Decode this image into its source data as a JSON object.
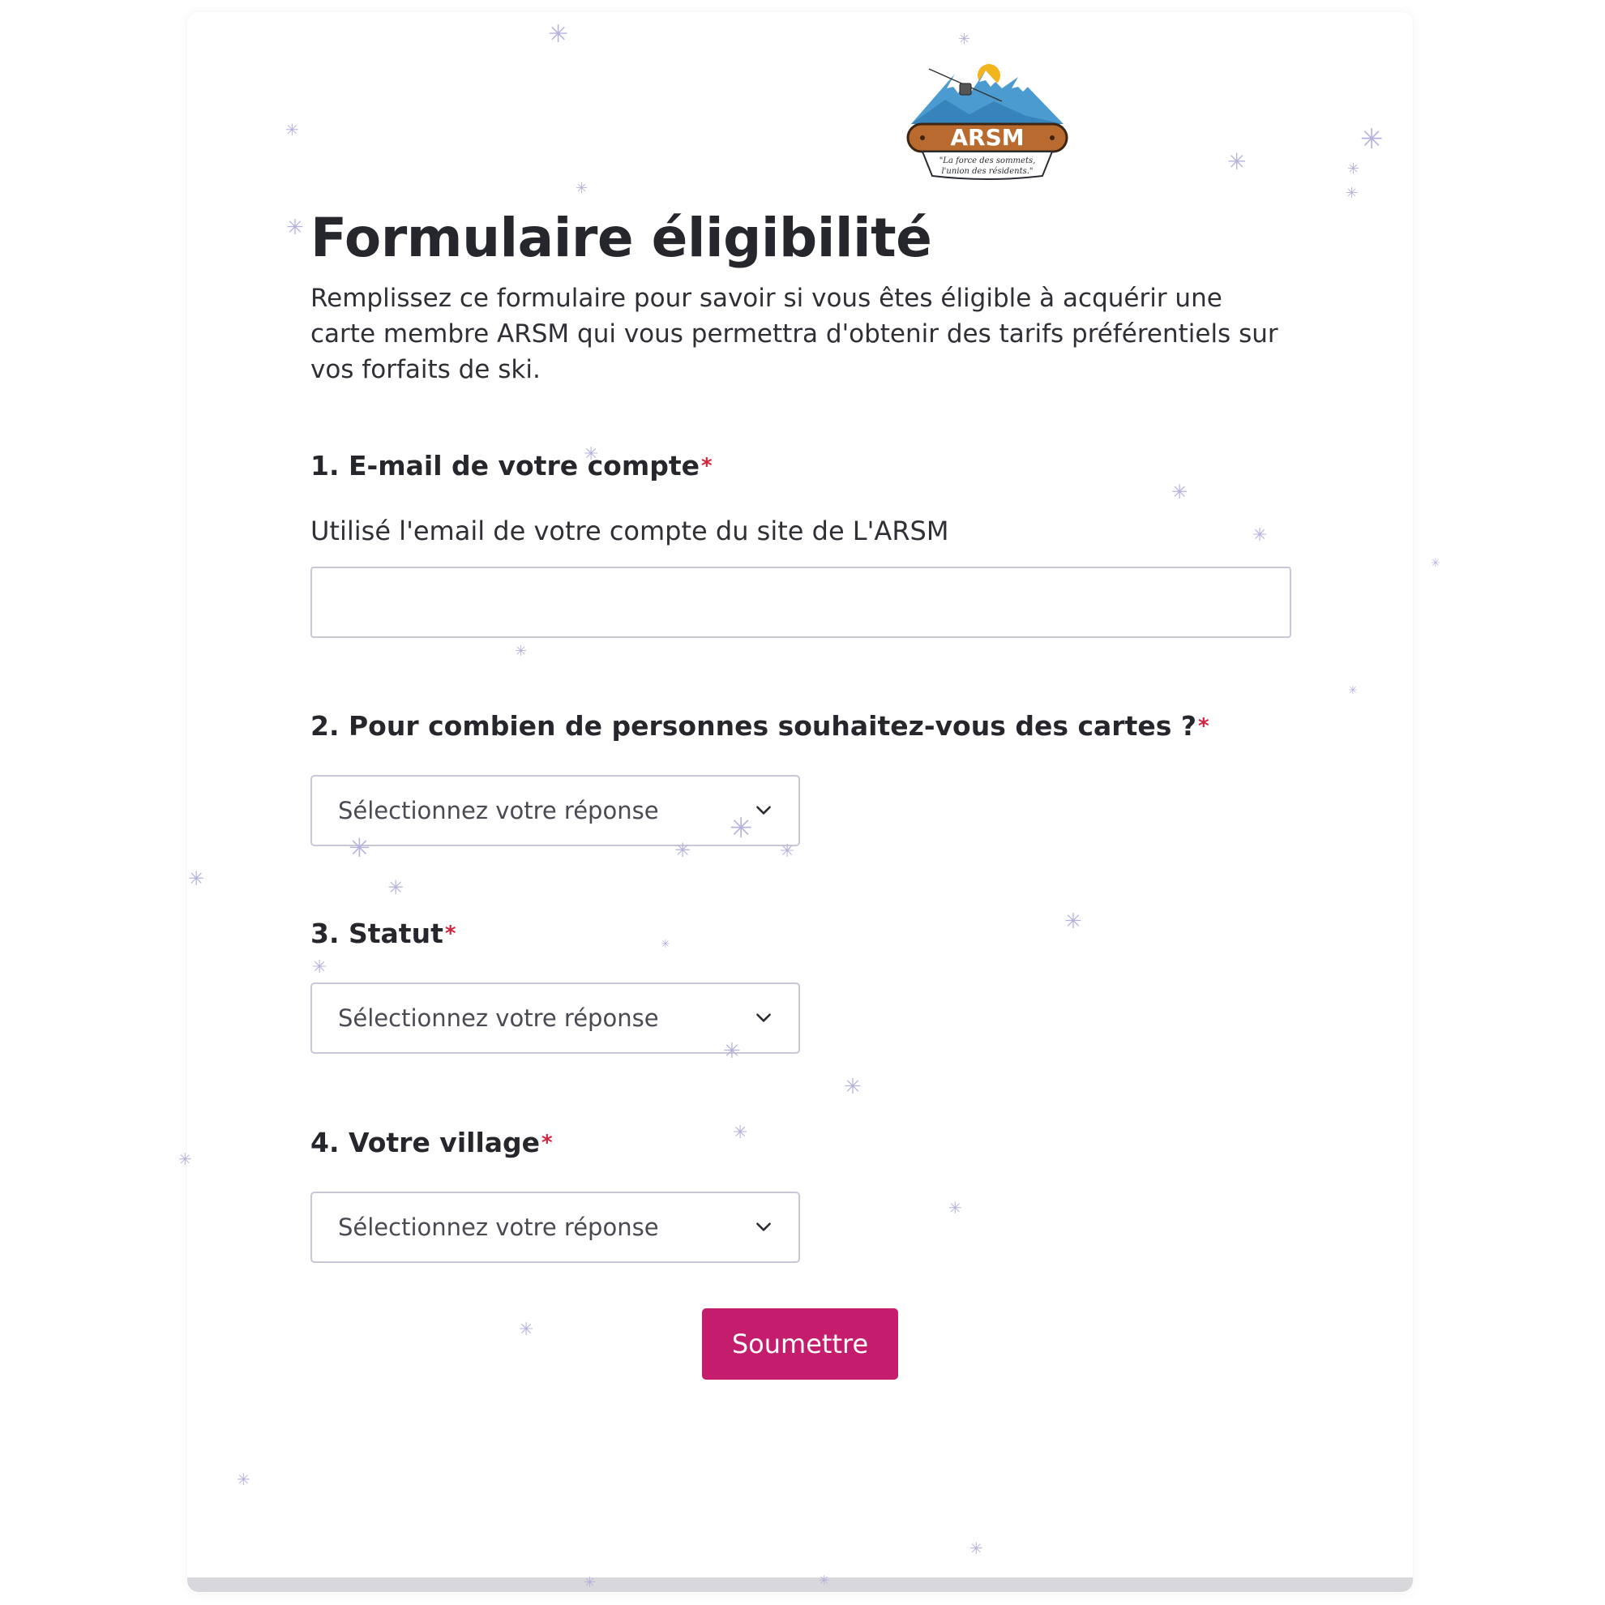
{
  "logo": {
    "brand_text": "ARSM",
    "tagline_line1": "\"La force des sommets,",
    "tagline_line2": "l'union des résidents.\""
  },
  "form": {
    "title": "Formulaire éligibilité",
    "description": "Remplissez ce formulaire pour savoir si vous êtes éligible à acquérir une carte membre ARSM qui vous permettra d'obtenir des tarifs préférentiels sur vos forfaits de ski.",
    "required_mark": "*",
    "questions": [
      {
        "label": "1. E-mail de votre compte",
        "help": "Utilisé l'email de votre compte du site de L'ARSM",
        "value": "",
        "placeholder": ""
      },
      {
        "label": "2. Pour combien de personnes souhaitez-vous des cartes ?",
        "selected": "Sélectionnez votre réponse"
      },
      {
        "label": "3. Statut",
        "selected": "Sélectionnez votre réponse"
      },
      {
        "label": "4. Votre village",
        "selected": "Sélectionnez votre réponse"
      }
    ],
    "submit_label": "Soumettre"
  },
  "colors": {
    "accent": "#c41d6d",
    "required": "#d0243f",
    "input_border": "#c9c6d6",
    "snowflake": "#b5b3dc"
  },
  "icons": {
    "dropdown": "chevron-down-icon",
    "decoration": "snowflake-icon"
  }
}
